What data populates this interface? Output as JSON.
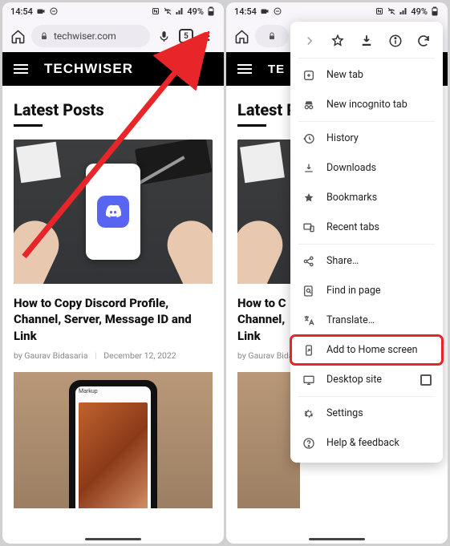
{
  "status": {
    "time": "14:54",
    "battery": "49%"
  },
  "omnibox": {
    "domain": "techwiser.com",
    "tab_count": "5"
  },
  "site": {
    "brand": "TECHWISER",
    "section": "Latest Posts"
  },
  "post": {
    "title": "How to Copy Discord Profile, Channel, Server, Message ID and Link",
    "author_prefix": "by",
    "author": "Gaurav Bidasaria",
    "date": "December 12, 2022"
  },
  "post2": {
    "app_label": "Markup"
  },
  "left_post_title_partial": "How to C\nChannel,\nLink",
  "menu": {
    "top": [
      "forward",
      "star",
      "download",
      "info",
      "reload"
    ],
    "items": [
      {
        "icon": "plus-box",
        "label": "New tab"
      },
      {
        "icon": "incognito",
        "label": "New incognito tab"
      },
      {
        "icon": "history",
        "label": "History"
      },
      {
        "icon": "download-underline",
        "label": "Downloads"
      },
      {
        "icon": "star-fill",
        "label": "Bookmarks"
      },
      {
        "icon": "devices",
        "label": "Recent tabs"
      },
      {
        "icon": "share",
        "label": "Share…"
      },
      {
        "icon": "find",
        "label": "Find in page"
      },
      {
        "icon": "translate",
        "label": "Translate…"
      },
      {
        "icon": "add-home",
        "label": "Add to Home screen",
        "highlight": true
      },
      {
        "icon": "monitor",
        "label": "Desktop site",
        "checkbox": true
      },
      {
        "icon": "gear",
        "label": "Settings"
      },
      {
        "icon": "help",
        "label": "Help & feedback"
      }
    ]
  }
}
